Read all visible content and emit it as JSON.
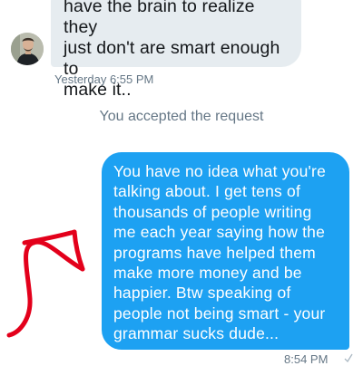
{
  "conversation": {
    "incoming_message": {
      "text": "have the brain to realize they\njust don't are smart enough to\nmake it..",
      "timestamp": "Yesterday 6:55 PM"
    },
    "system_message": "You accepted the request",
    "outgoing_message": {
      "text": "You have no idea what you're\ntalking about. I get tens of\nthousands of people writing\nme each year saying how the\nprograms have helped them\nmake more money and be\nhappier. Btw speaking of\npeople not being smart - your\ngrammar sucks dude...",
      "timestamp": "8:54 PM",
      "status_icon": "check-icon"
    }
  },
  "annotation": {
    "type": "arrow",
    "color": "#e3001b"
  },
  "colors": {
    "incoming_bubble": "#e6ecf0",
    "outgoing_bubble": "#1da1f2",
    "meta_text": "#657786"
  }
}
